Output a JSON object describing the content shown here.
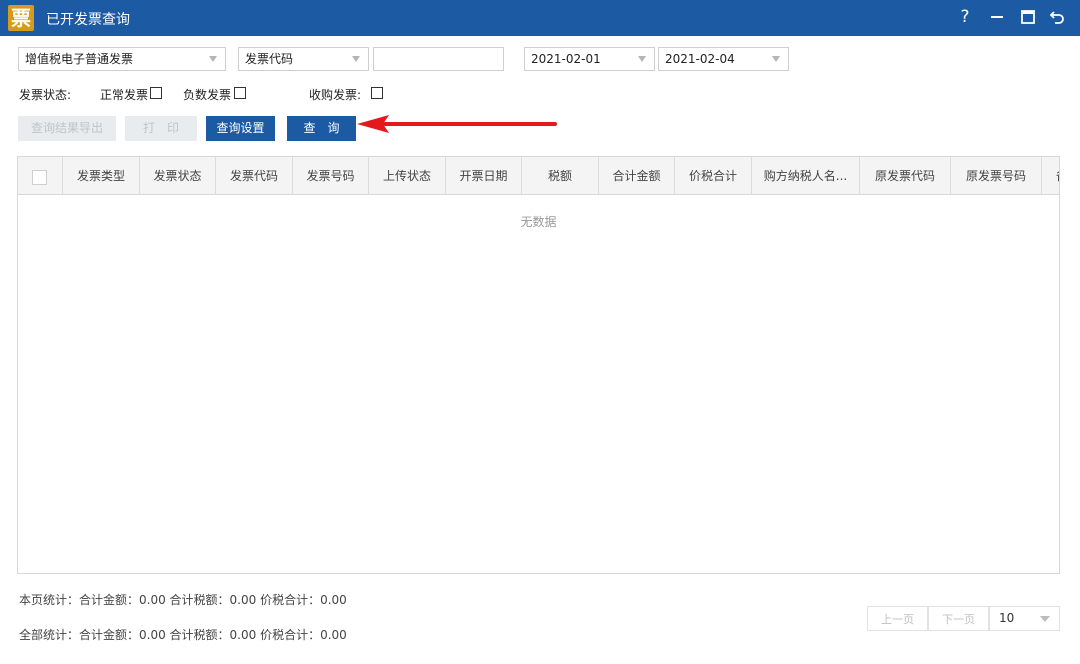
{
  "window": {
    "logo_char": "票",
    "title": "已开发票查询",
    "help_label": "?"
  },
  "filters": {
    "invoice_type": "增值税电子普通发票",
    "search_field": "发票代码",
    "search_value": "",
    "date_start": "2021-02-01",
    "date_end": "2021-02-04"
  },
  "status": {
    "label": "发票状态:",
    "normal_label": "正常发票",
    "negative_label": "负数发票",
    "purchase_label": "收购发票:"
  },
  "buttons": {
    "export": "查询结果导出",
    "print": "打　印",
    "settings": "查询设置",
    "query": "查　询"
  },
  "table": {
    "columns": [
      "发票类型",
      "发票状态",
      "发票代码",
      "发票号码",
      "上传状态",
      "开票日期",
      "税额",
      "合计金额",
      "价税合计",
      "购方纳税人名...",
      "原发票代码",
      "原发票号码",
      "备"
    ],
    "empty_text": "无数据"
  },
  "footer": {
    "page_stats": "本页统计：合计金额：0.00  合计税额：0.00    价税合计：0.00",
    "total_stats": "全部统计：合计金额：0.00  合计税额：0.00    价税合计：0.00",
    "prev_page": "上一页",
    "next_page": "下一页",
    "page_size": "10"
  },
  "colors": {
    "accent": "#1c5aa3",
    "arrow": "#e5191c",
    "logo": "#d99a1c"
  }
}
